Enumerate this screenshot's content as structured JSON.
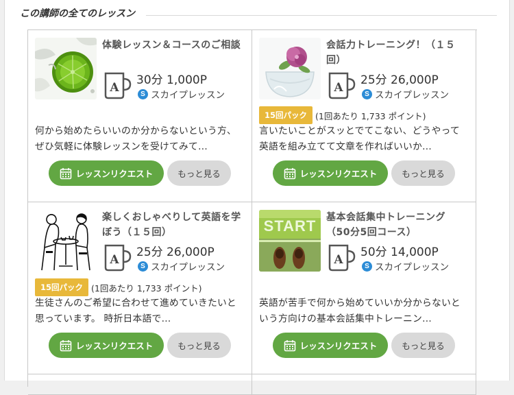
{
  "section": {
    "title": "この講師の全てのレッスン"
  },
  "lessons": [
    {
      "title": "体験レッスン＆コースのご相談",
      "price": "30分 1,000P",
      "platform": "スカイプレッスン",
      "pack": null,
      "description": "何から始めたらいいのか分からないという方、ぜひ気軽に体験レッスンを受けてみて…",
      "image": "lime-splash-photo",
      "request_label": "レッスンリクエスト",
      "more_label": "もっと見る"
    },
    {
      "title": "会話力トレーニング！（１５回）",
      "price": "25分 26,000P",
      "platform": "スカイプレッスン",
      "pack": {
        "badge": "15回パック",
        "note": "(1回あたり 1,733 ポイント)"
      },
      "description": "言いたいことがスッとでてこない、どうやって英語を組み立てて文章を作ればいいか…",
      "image": "flower-glass-photo",
      "request_label": "レッスンリクエスト",
      "more_label": "もっと見る"
    },
    {
      "title": "楽しくおしゃべりして英語を学ぼう（１５回）",
      "price": "25分 26,000P",
      "platform": "スカイプレッスン",
      "pack": {
        "badge": "15回パック",
        "note": "(1回あたり 1,733 ポイント)"
      },
      "description": "生徒さんのご希望に合わせて進めていきたいと思っています。 時折日本語で…",
      "image": "cafe-sketch-illustration",
      "request_label": "レッスンリクエスト",
      "more_label": "もっと見る"
    },
    {
      "title": "基本会話集中トレーニング（50分5回コース）",
      "price": "50分 14,000P",
      "platform": "スカイプレッスン",
      "pack": null,
      "description": "英語が苦手で何から始めていいか分からないという方向けの基本会話集中トレーニン…",
      "image": "start-shoes-photo",
      "start_text": "START",
      "request_label": "レッスンリクエスト",
      "more_label": "もっと見る"
    }
  ],
  "icons": {
    "mug_letter": "A",
    "skype_letter": "S",
    "accent_green": "#62a743",
    "badge_yellow": "#e8b83a"
  }
}
